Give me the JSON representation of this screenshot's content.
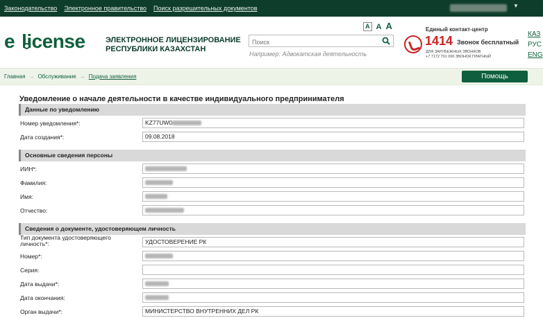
{
  "topbar": {
    "links": [
      "Законодательство",
      "Электронное правительство",
      "Поиск разрешительных документов"
    ]
  },
  "header": {
    "logo_prefix": "e",
    "logo_suffix": "license",
    "brand_line1": "ЭЛЕКТРОННОЕ ЛИЦЕНЗИРОВАНИЕ",
    "brand_line2": "РЕСПУБЛИКИ КАЗАХСТАН",
    "font_sizes": [
      "A",
      "A",
      "A"
    ],
    "search_placeholder": "Поиск",
    "search_hint": "Например: Адвокатская деятельность",
    "contact_title": "Единый контакт-центр",
    "contact_number": "1414",
    "contact_free": "Звонок бесплатный",
    "contact_intl_1": "ДЛЯ ЗАРУБЕЖНЫХ ЗВОНКОВ",
    "contact_intl_2": "+7 7172 701 000 ЗВОНОК ПЛАТНЫЙ",
    "languages": [
      "КАЗ",
      "РУС",
      "ENG"
    ]
  },
  "breadcrumb": {
    "items": [
      "Главная",
      "Обслуживание",
      "Подача заявления"
    ],
    "separator": "→"
  },
  "help_button": "Помощь",
  "page": {
    "title": "Уведомление о начале деятельности в качестве индивидуального предпринимателя"
  },
  "sections": {
    "notice": {
      "title": "Данные по уведомлению",
      "number_label": "Номер уведомления*:",
      "number_value": "KZ77UW0",
      "date_label": "Дата создания*:",
      "date_value": "09.08.2018"
    },
    "person": {
      "title": "Основные сведения персоны",
      "iin_label": "ИИН*:",
      "surname_label": "Фамилия:",
      "name_label": "Имя:",
      "patronymic_label": "Отчество:"
    },
    "document": {
      "title": "Сведения о документе, удостоверяющем личность",
      "type_label": "Тип документа удостоверяющего личность*:",
      "type_value": "УДОСТОВЕРЕНИЕ РК",
      "number_label": "Номер*:",
      "series_label": "Серия:",
      "issue_date_label": "Дата выдачи*:",
      "expiry_date_label": "Дата окончания:",
      "issuer_label": "Орган выдачи*:",
      "issuer_value": "МИНИСТЕРСТВО ВНУТРЕННИХ ДЕЛ РК"
    }
  },
  "colors": {
    "brand_green": "#0f5f3e",
    "topbar_bg": "#0e3d2c",
    "contact_red": "#cc2222",
    "section_bg": "#d9d9d9"
  }
}
